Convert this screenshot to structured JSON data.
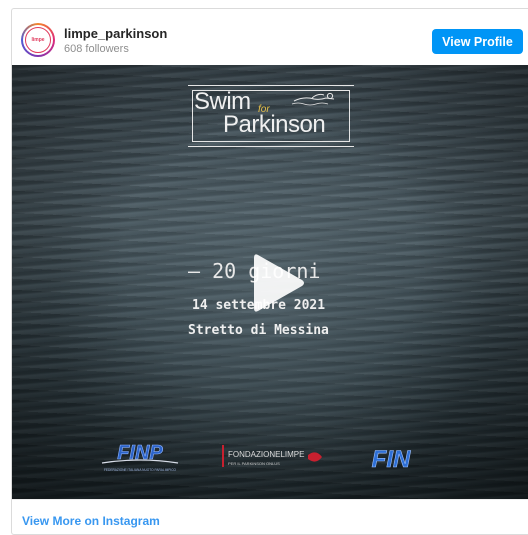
{
  "header": {
    "avatar_icon": "limpe-logo-icon",
    "avatar_text": "limpe",
    "username": "limpe_parkinson",
    "followers": "608 followers",
    "view_profile_label": "View Profile"
  },
  "media": {
    "type": "video",
    "logo": {
      "swim": "Swim",
      "for": "for",
      "parkinson": "Parkinson"
    },
    "countdown": "– 20 giorni",
    "date": "14 settembre 2021",
    "place": "Stretto di Messina",
    "play_icon": "play-icon",
    "sponsors": [
      {
        "label": "FINP",
        "sub": "FEDERAZIONE ITALIANA NUOTO PARALIMPICO"
      },
      {
        "label": "FONDAZIONELIMPE",
        "sub": "PER IL PARKINSON ONLUS"
      },
      {
        "label": "FIN",
        "sub": ""
      }
    ]
  },
  "footer": {
    "view_more_label": "View More on Instagram"
  },
  "colors": {
    "button_blue": "#0095f6",
    "link_blue": "#3897f0",
    "logo_accent": "#e8c14a"
  }
}
